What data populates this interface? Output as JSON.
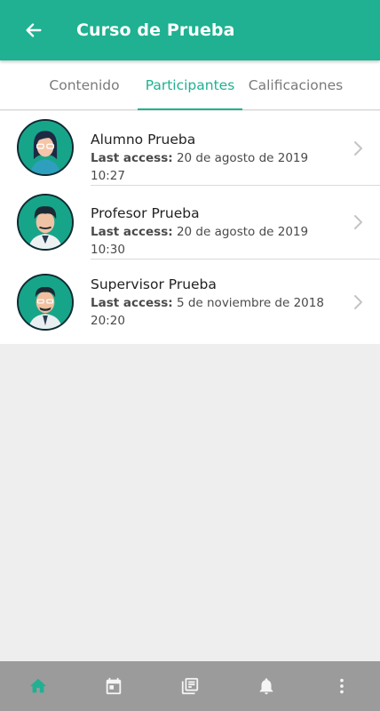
{
  "header": {
    "title": "Curso de Prueba",
    "back_icon": "arrow-left-icon"
  },
  "tabs": [
    {
      "label": "Contenido",
      "active": false
    },
    {
      "label": "Participantes",
      "active": true
    },
    {
      "label": "Calificaciones",
      "active": false
    }
  ],
  "participants": [
    {
      "name": "Alumno Prueba",
      "last_access_label": "Last access:",
      "last_access_value": "20 de agosto de 2019 10:27",
      "avatar": "female-student-avatar"
    },
    {
      "name": "Profesor Prueba",
      "last_access_label": "Last access:",
      "last_access_value": "20 de agosto de 2019 10:30",
      "avatar": "male-teacher-avatar"
    },
    {
      "name": "Supervisor Prueba",
      "last_access_label": "Last access:",
      "last_access_value": "5 de noviembre de 2018 20:20",
      "avatar": "male-supervisor-avatar"
    }
  ],
  "bottom_nav": [
    {
      "icon": "home-icon",
      "active": true
    },
    {
      "icon": "calendar-icon",
      "active": false
    },
    {
      "icon": "courses-icon",
      "active": false
    },
    {
      "icon": "bell-icon",
      "active": false
    },
    {
      "icon": "more-vertical-icon",
      "active": false
    }
  ],
  "colors": {
    "brand": "#1fb191",
    "bottom_bar": "#9b9b9b",
    "background": "#eeeeee"
  }
}
